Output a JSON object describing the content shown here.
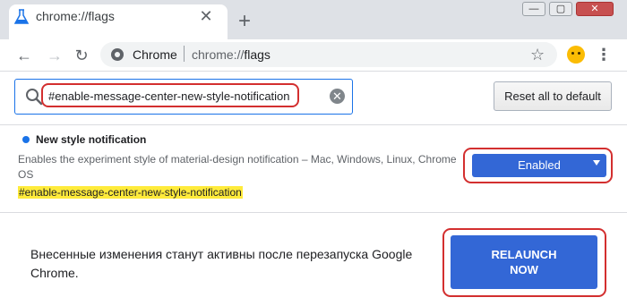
{
  "tab": {
    "title": "chrome://flags",
    "close_glyph": "✕",
    "new_tab_glyph": "+"
  },
  "window_controls": {
    "minimize": "—",
    "maximize": "▢",
    "close": "✕"
  },
  "toolbar": {
    "back_glyph": "←",
    "forward_glyph": "→",
    "reload_glyph": "↻",
    "site_name": "Chrome",
    "url_scheme": "chrome://",
    "url_path": "flags",
    "star_glyph": "☆",
    "menu_glyph": "⋮"
  },
  "search": {
    "value": "#enable-message-center-new-style-notification",
    "clear_glyph": "✕"
  },
  "reset_button": "Reset all to default",
  "experiment": {
    "title": "New style notification",
    "description": "Enables the experiment style of material-design notification – Mac, Windows, Linux, Chrome OS",
    "tag": "#enable-message-center-new-style-notification",
    "selected_option": "Enabled"
  },
  "relaunch_banner": {
    "message": "Внесенные изменения станут активны после перезапуска Google Chrome.",
    "button_line1": "RELAUNCH",
    "button_line2": "NOW"
  },
  "colors": {
    "accent": "#3367d6",
    "highlight_outline": "#d32f2f",
    "tag_highlight": "#ffeb3b"
  }
}
